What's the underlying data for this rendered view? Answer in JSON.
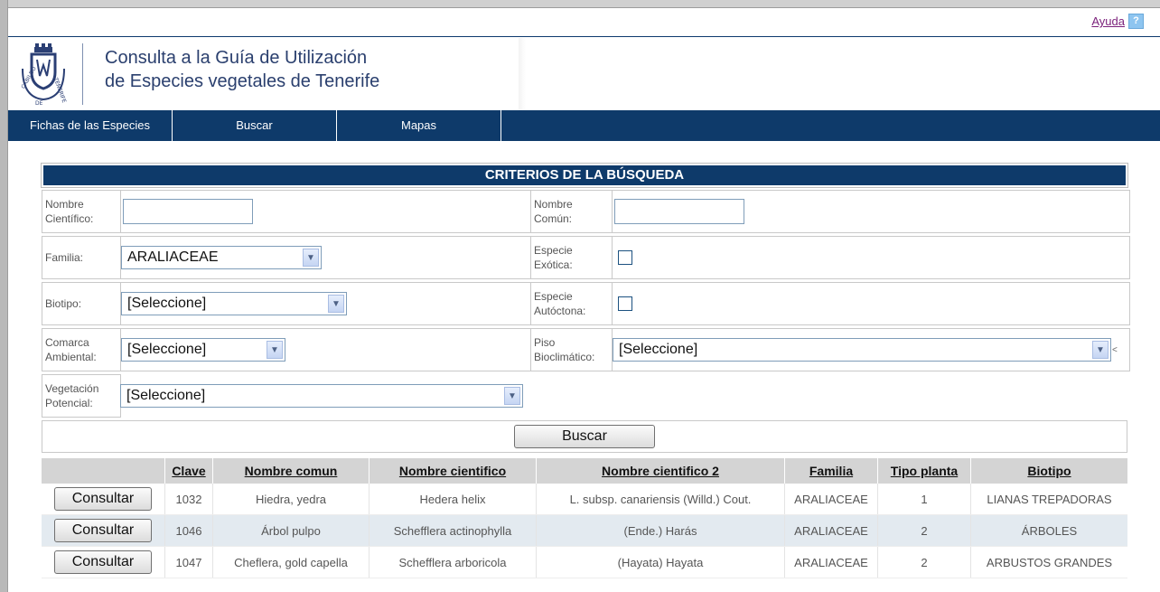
{
  "help": {
    "label": "Ayuda",
    "icon": "help-question-icon",
    "icon_text": "?"
  },
  "header": {
    "title_line1": "Consulta a la Guía de Utilización",
    "title_line2": "de Especies vegetales de Tenerife",
    "logo_text": "CABILDO DE TENERIFE"
  },
  "nav": {
    "items": [
      {
        "label": "Fichas de las Especies"
      },
      {
        "label": "Buscar"
      },
      {
        "label": "Mapas"
      }
    ]
  },
  "criteria": {
    "title": "CRITERIOS DE LA BÚSQUEDA",
    "nombre_cientifico_label": "Nombre Científico:",
    "nombre_cientifico_value": "",
    "nombre_comun_label": "Nombre Común:",
    "nombre_comun_value": "",
    "familia_label": "Familia:",
    "familia_value": "ARALIACEAE",
    "especie_exotica_label": "Especie Exótica:",
    "especie_exotica_checked": false,
    "biotipo_label": "Biotipo:",
    "biotipo_value": "[Seleccione]",
    "especie_autoctona_label": "Especie Autóctona:",
    "especie_autoctona_checked": false,
    "comarca_label": "Comarca Ambiental:",
    "comarca_value": "[Seleccione]",
    "piso_label": "Piso Bioclimático:",
    "piso_value": "[Seleccione]",
    "piso_suffix": "<",
    "vegetacion_label": "Vegetación Potencial:",
    "vegetacion_value": "[Seleccione]",
    "buscar_label": "Buscar"
  },
  "results": {
    "headers": [
      "",
      "Clave",
      "Nombre comun",
      "Nombre cientifico",
      "Nombre cientifico 2",
      "Familia",
      "Tipo planta",
      "Biotipo"
    ],
    "consultar_label": "Consultar",
    "rows": [
      {
        "clave": "1032",
        "nombre_comun": "Hiedra, yedra",
        "nombre_cientifico": "Hedera helix",
        "nombre_cientifico_2": "L. subsp. canariensis (Willd.) Cout.",
        "familia": "ARALIACEAE",
        "tipo_planta": "1",
        "biotipo": "LIANAS TREPADORAS"
      },
      {
        "clave": "1046",
        "nombre_comun": "Árbol pulpo",
        "nombre_cientifico": "Schefflera actinophylla",
        "nombre_cientifico_2": "(Ende.) Harás",
        "familia": "ARALIACEAE",
        "tipo_planta": "2",
        "biotipo": "ÁRBOLES"
      },
      {
        "clave": "1047",
        "nombre_comun": "Cheflera, gold capella",
        "nombre_cientifico": "Schefflera arboricola",
        "nombre_cientifico_2": "(Hayata) Hayata",
        "familia": "ARALIACEAE",
        "tipo_planta": "2",
        "biotipo": "ARBUSTOS GRANDES"
      }
    ]
  }
}
